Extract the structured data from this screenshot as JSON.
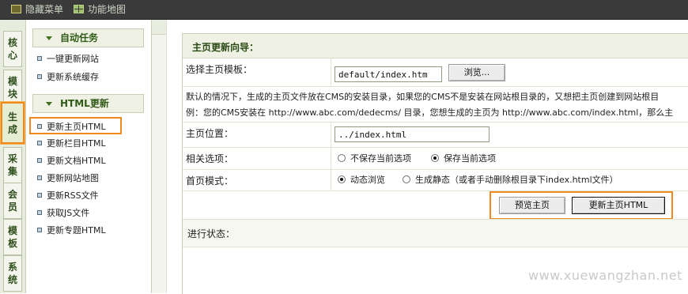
{
  "topbar": {
    "hide_menu": "隐藏菜单",
    "function_map": "功能地图"
  },
  "left_tabs": [
    {
      "label_1": "核",
      "label_2": "心"
    },
    {
      "label_1": "模",
      "label_2": "块"
    },
    {
      "label_1": "生",
      "label_2": "成"
    },
    {
      "label_1": "采",
      "label_2": "集"
    },
    {
      "label_1": "会",
      "label_2": "员"
    },
    {
      "label_1": "模",
      "label_2": "板"
    },
    {
      "label_1": "系",
      "label_2": "统"
    }
  ],
  "menu": {
    "section1_title": "自动任务",
    "section1_items": [
      "一键更新网站",
      "更新系统缓存"
    ],
    "section2_title": "HTML更新",
    "section2_items": [
      "更新主页HTML",
      "更新栏目HTML",
      "更新文档HTML",
      "更新网站地图",
      "更新RSS文件",
      "获取JS文件",
      "更新专题HTML"
    ]
  },
  "main": {
    "title": "主页更新向导：",
    "template_label": "选择主页模板：",
    "template_value": "default/index.htm",
    "browse_button": "浏览...",
    "desc_line1": "默认的情况下，生成的主页文件放在CMS的安装目录，如果您的CMS不是安装在网站根目录的，又想把主页创建到网站根目",
    "desc_line2": "例：您的CMS安装在 http://www.abc.com/dedecms/ 目录，您想生成的主页为 http://www.abc.com/index.html，那么主",
    "position_label": "主页位置：",
    "position_value": "../index.html",
    "options_label": "相关选项：",
    "option_no_save": "不保存当前选项",
    "option_save": "保存当前选项",
    "mode_label": "首页模式：",
    "mode_dynamic": "动态浏览",
    "mode_static": "生成静态（或者手动删除根目录下index.html文件）",
    "preview_button": "预览主页",
    "update_button": "更新主页HTML",
    "status_label": "进行状态："
  },
  "watermark": "www.xuewangzhan.net",
  "colors": {
    "highlight": "#f08a1d",
    "topbar": "#3a3a3a",
    "header_bg": "#eef1e4"
  }
}
